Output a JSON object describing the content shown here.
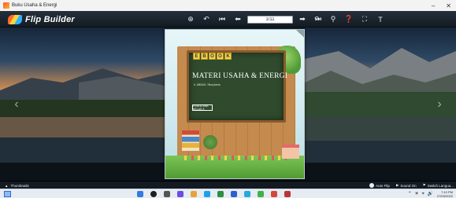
{
  "window": {
    "title": "Buku Usaha & Energi"
  },
  "toolbar": {
    "brand": "Flip Builder",
    "page_value": "1/11"
  },
  "book_cover": {
    "tiles": [
      "E",
      "B",
      "O",
      "O",
      "K"
    ],
    "title": "MATERI USAHA & ENERGI",
    "author": "Ir. ABBAS. Sitorplants",
    "label": "FISIKA SMA KELAS X"
  },
  "bottom_bar": {
    "thumbnails": "Thumbnails",
    "auto_flip": "Auto Flip",
    "sound_on": "Sound On",
    "switch_language": "Switch Langua..."
  },
  "taskbar": {
    "time": "7:10 PM",
    "date": "27/03/2022"
  }
}
